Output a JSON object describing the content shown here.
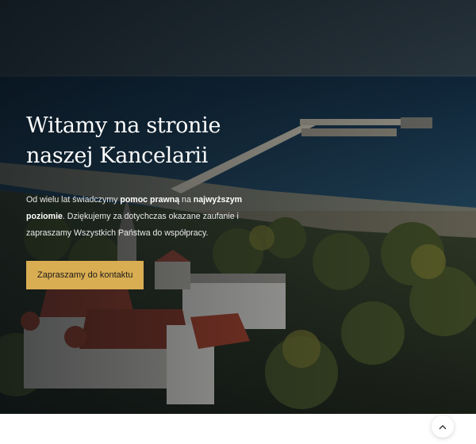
{
  "hero": {
    "title_line1": "Witamy na stronie",
    "title_line2": "naszej Kancelarii",
    "intro": {
      "part1": "Od wielu lat świadczymy ",
      "bold1": "pomoc prawną",
      "part2": " na ",
      "bold2": "najwyższym poziomie",
      "part3": ". Dziękujemy za dotychczas okazane zaufanie i zapraszamy Wszystkich Państwa do współpracy."
    },
    "cta_label": "Zapraszamy do kontaktu",
    "background": "aerial-photo-coast-pier-town"
  },
  "scroll_top": {
    "icon": "chevron-up-icon"
  },
  "colors": {
    "accent": "#d9ad52",
    "overlay": "#060c12",
    "sea": "#17324a",
    "page_bg": "#ffffff"
  }
}
